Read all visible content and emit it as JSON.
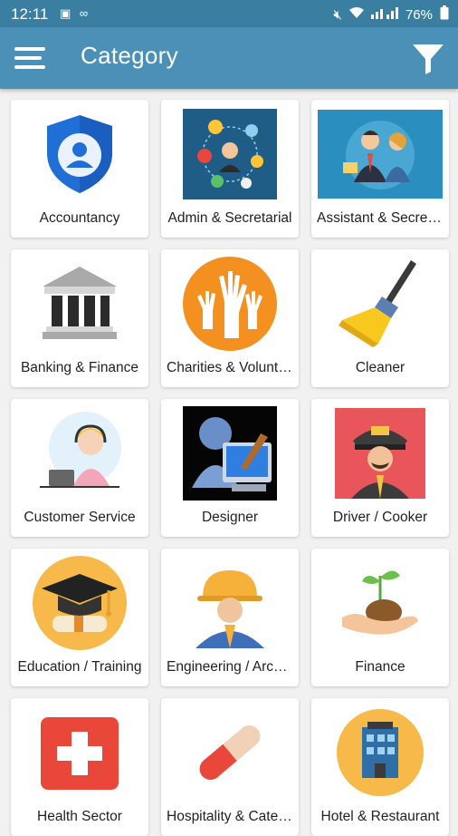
{
  "status": {
    "time": "12:11",
    "battery": "76%"
  },
  "appbar": {
    "title": "Category"
  },
  "categories": [
    {
      "label": "Accountancy",
      "icon": "shield-user-icon"
    },
    {
      "label": "Admin & Secretarial",
      "icon": "admin-network-icon"
    },
    {
      "label": "Assistant & Secretarial",
      "icon": "assistant-people-icon"
    },
    {
      "label": "Banking & Finance",
      "icon": "bank-building-icon"
    },
    {
      "label": "Charities & Voluntary",
      "icon": "raised-hands-icon"
    },
    {
      "label": "Cleaner",
      "icon": "broom-icon"
    },
    {
      "label": "Customer Service",
      "icon": "headset-agent-icon"
    },
    {
      "label": "Designer",
      "icon": "computer-designer-icon"
    },
    {
      "label": "Driver / Cooker",
      "icon": "taxi-driver-icon"
    },
    {
      "label": "Education / Training",
      "icon": "graduation-cap-icon"
    },
    {
      "label": "Engineering / Architecture",
      "icon": "engineer-helmet-icon"
    },
    {
      "label": "Finance",
      "icon": "plant-coin-hand-icon"
    },
    {
      "label": "Health Sector",
      "icon": "medical-cross-icon"
    },
    {
      "label": "Hospitality & Catering",
      "icon": "pill-capsule-icon"
    },
    {
      "label": "Hotel & Restaurant",
      "icon": "hotel-building-icon"
    }
  ]
}
